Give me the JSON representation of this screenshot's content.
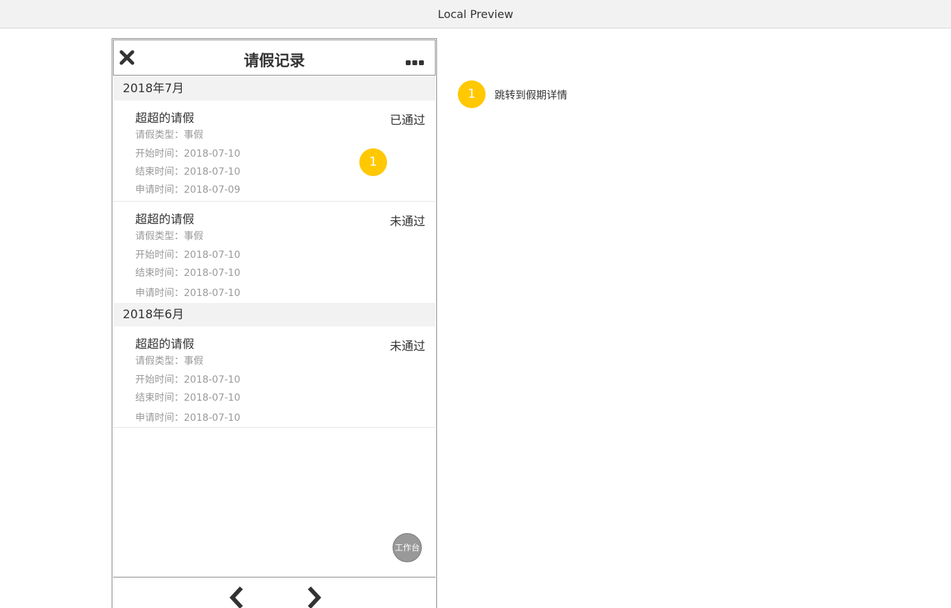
{
  "window": {
    "title": "Local Preview"
  },
  "header": {
    "title": "请假记录",
    "close_icon": "close-icon",
    "more_icon": "more-dots-icon"
  },
  "months": [
    {
      "label": "2018年7月",
      "records": [
        {
          "name": "超超的请假",
          "status": "已通过",
          "type": "请假类型：事假",
          "start": "开始时间：2018-07-10",
          "end": "结束时间：2018-07-10",
          "applied": "申请时间：2018-07-09"
        },
        {
          "name": "超超的请假",
          "status": "未通过",
          "type": "请假类型：事假",
          "start": "开始时间：2018-07-10",
          "end": "结束时间：2018-07-10",
          "applied": "申请时间：2018-07-10"
        }
      ]
    },
    {
      "label": "2018年6月",
      "records": [
        {
          "name": "超超的请假",
          "status": "未通过",
          "type": "请假类型：事假",
          "start": "开始时间：2018-07-10",
          "end": "结束时间：2018-07-10",
          "applied": "申请时间：2018-07-10"
        }
      ]
    }
  ],
  "marker": {
    "number": "1",
    "color": "#ffc800"
  },
  "float_button": {
    "label": "工作台"
  },
  "bottom_nav": {
    "back_icon": "chevron-left-icon",
    "forward_icon": "chevron-right-icon"
  },
  "annotation": {
    "number": "1",
    "text": "跳转到假期详情"
  }
}
